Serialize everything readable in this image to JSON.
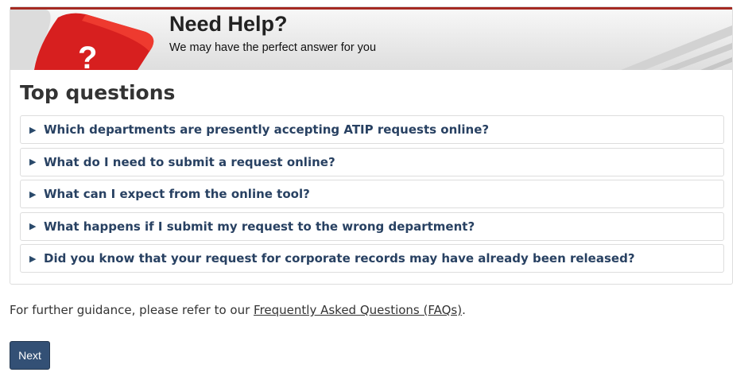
{
  "banner": {
    "title": "Need Help?",
    "subtitle": "We may have the perfect answer for you",
    "accent_color": "#a52a22",
    "icon": "question-key-icon"
  },
  "section_title": "Top questions",
  "questions": [
    {
      "label": "Which departments are presently accepting ATIP requests online?"
    },
    {
      "label": "What do I need to submit a request online?"
    },
    {
      "label": "What can I expect from the online tool?"
    },
    {
      "label": "What happens if I submit my request to the wrong department?"
    },
    {
      "label": "Did you know that your request for corporate records may have already been released?"
    }
  ],
  "guidance": {
    "prefix": "For further guidance, please refer to our ",
    "link": "Frequently Asked Questions (FAQs)",
    "suffix": "."
  },
  "next_button": {
    "label": "Next",
    "color": "#335075"
  },
  "colors": {
    "question_text": "#284162",
    "border": "#dddddd"
  }
}
